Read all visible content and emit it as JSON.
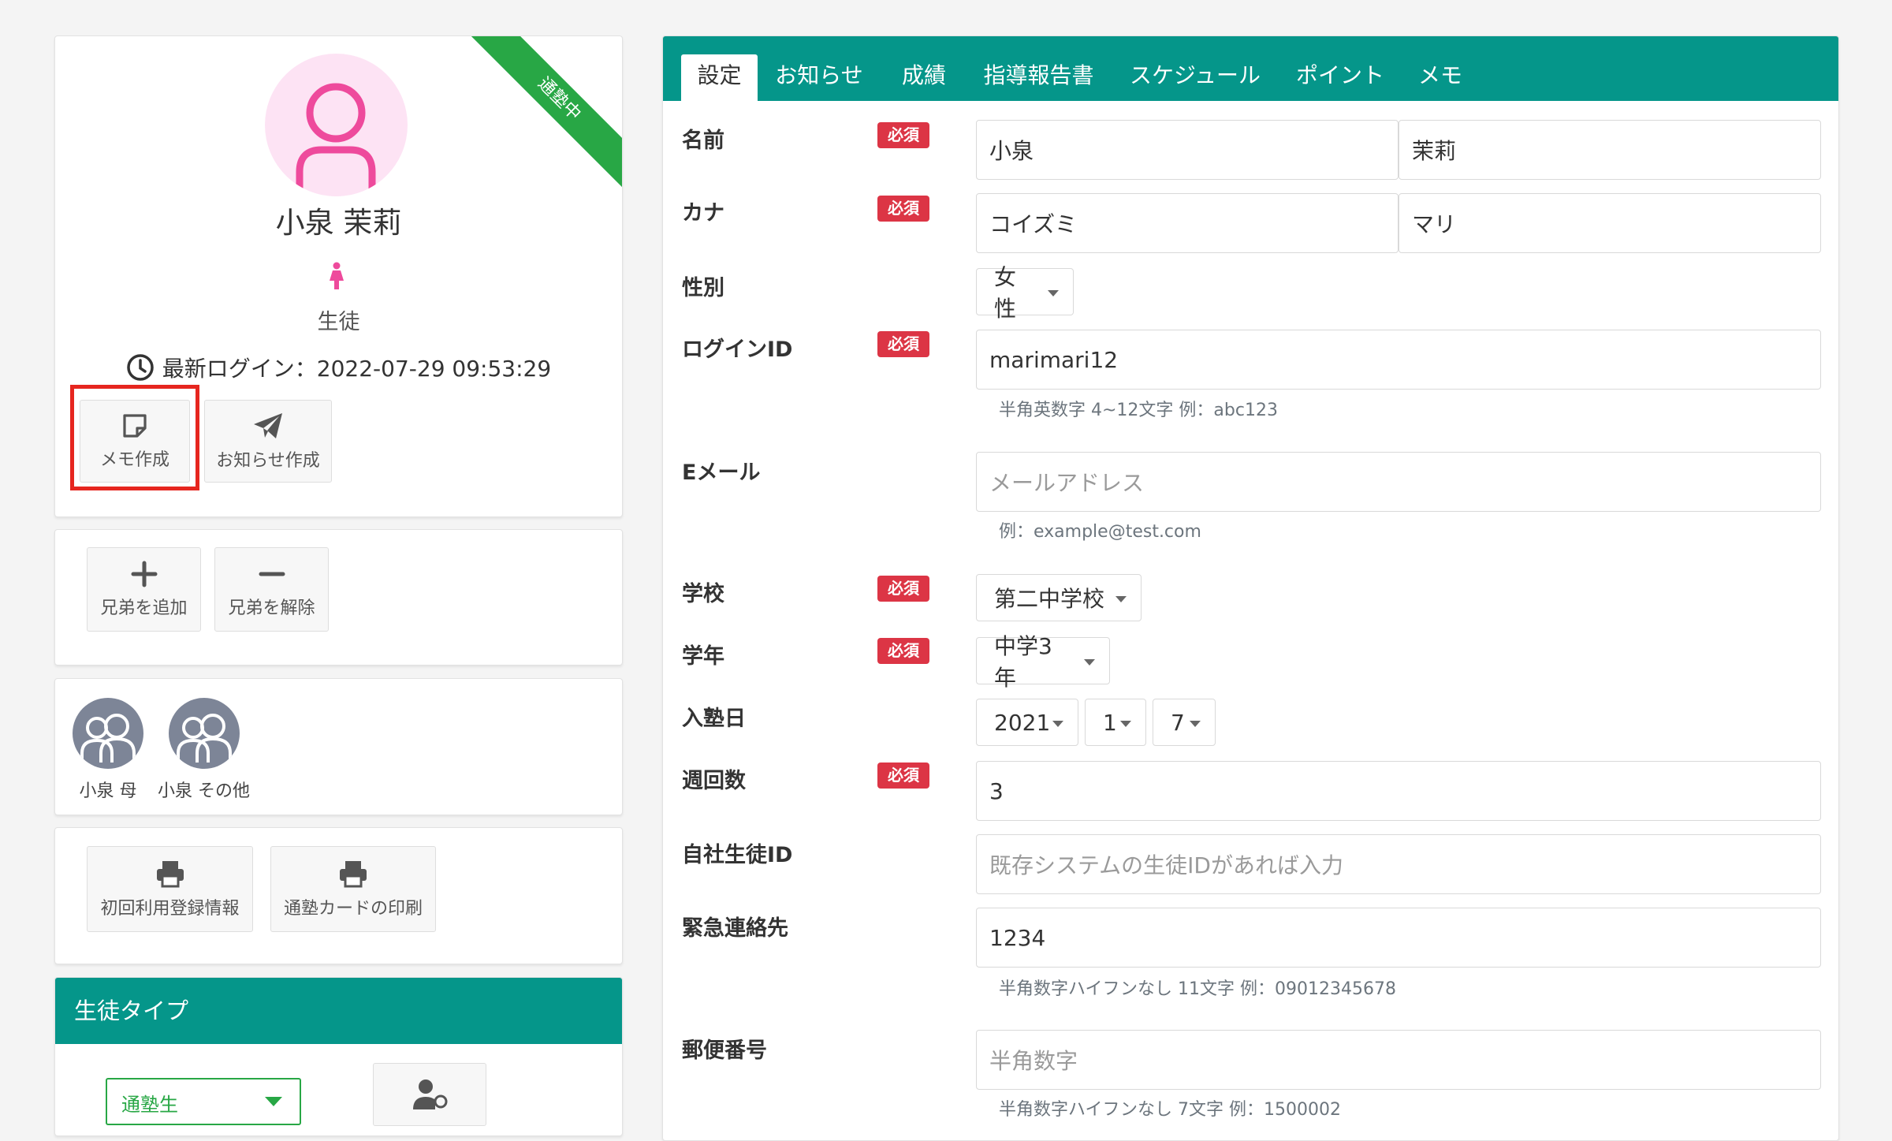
{
  "profile": {
    "ribbon": "通塾中",
    "name": "小泉 茉莉",
    "role": "生徒",
    "last_login_label": "最新ログイン：2022-07-29 09:53:29",
    "create_memo": "メモ作成",
    "create_notice": "お知らせ作成"
  },
  "siblings": {
    "add": "兄弟を追加",
    "remove": "兄弟を解除"
  },
  "family": [
    {
      "name": "小泉 母"
    },
    {
      "name": "小泉 その他"
    }
  ],
  "print": {
    "first_registration": "初回利用登録情報",
    "card": "通塾カードの印刷"
  },
  "student_type": {
    "header": "生徒タイプ",
    "value": "通塾生"
  },
  "tabs": [
    "設定",
    "お知らせ",
    "成績",
    "指導報告書",
    "スケジュール",
    "ポイント",
    "メモ"
  ],
  "form": {
    "required_badge": "必須",
    "name": {
      "label": "名前",
      "last": "小泉",
      "first": "茉莉"
    },
    "kana": {
      "label": "カナ",
      "last": "コイズミ",
      "first": "マリ"
    },
    "gender": {
      "label": "性別",
      "value": "女性"
    },
    "login_id": {
      "label": "ログインID",
      "value": "marimari12",
      "hint": "半角英数字 4~12文字 例：abc123"
    },
    "email": {
      "label": "Eメール",
      "placeholder": "メールアドレス",
      "hint": "例：example@test.com"
    },
    "school": {
      "label": "学校",
      "value": "第二中学校"
    },
    "grade": {
      "label": "学年",
      "value": "中学3年"
    },
    "enroll_date": {
      "label": "入塾日",
      "year": "2021",
      "month": "1",
      "day": "7"
    },
    "weekly_count": {
      "label": "週回数",
      "value": "3"
    },
    "company_id": {
      "label": "自社生徒ID",
      "placeholder": "既存システムの生徒IDがあれば入力"
    },
    "emergency": {
      "label": "緊急連絡先",
      "value": "1234",
      "hint": "半角数字ハイフンなし 11文字 例：09012345678"
    },
    "postal": {
      "label": "郵便番号",
      "placeholder": "半角数字",
      "hint": "半角数字ハイフンなし 7文字 例：1500002"
    }
  },
  "colors": {
    "teal": "#05968a",
    "required": "#dc3545",
    "active_green": "#28a745",
    "highlight": "#e6261f",
    "avatar_pink": "#ee4a9c"
  }
}
